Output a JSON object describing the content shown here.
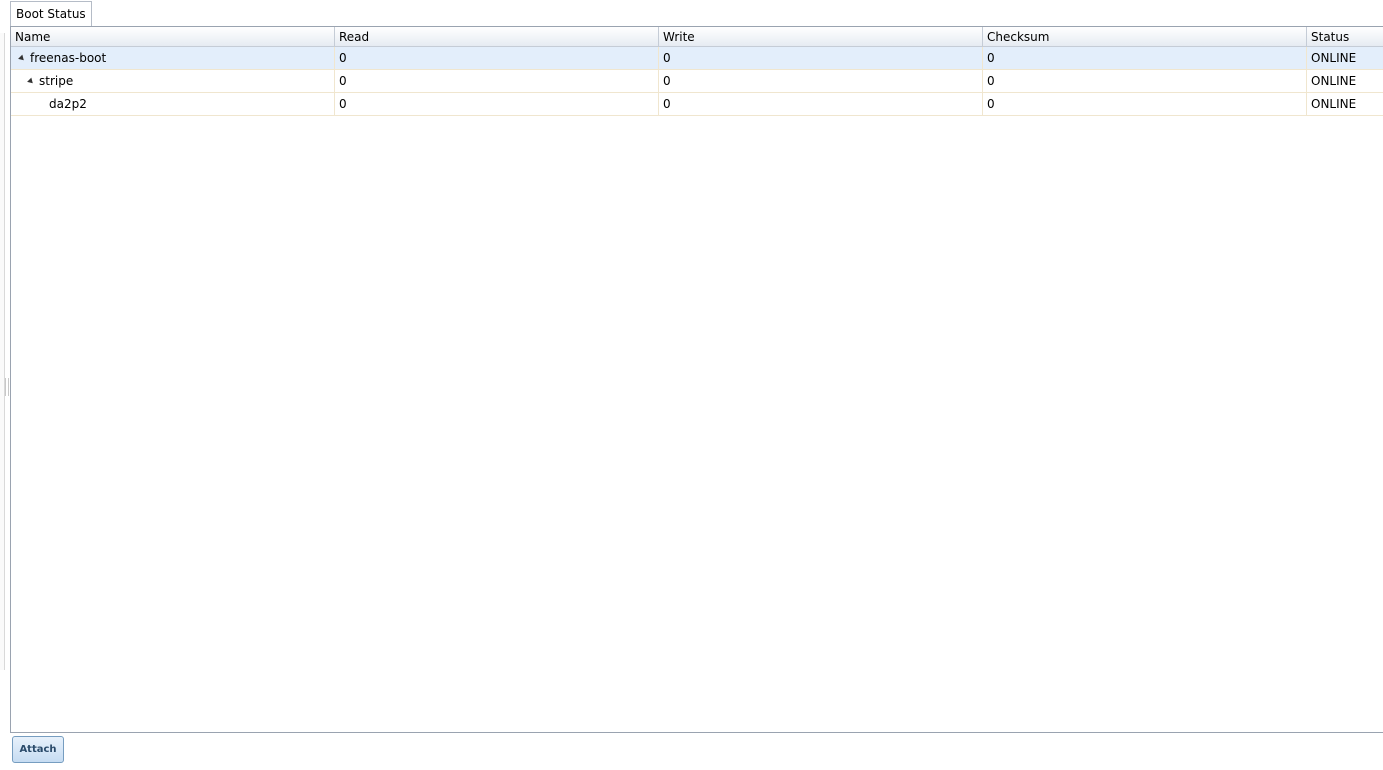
{
  "tabs": [
    {
      "label": "Boot Status"
    }
  ],
  "grid": {
    "columns": [
      "Name",
      "Read",
      "Write",
      "Checksum",
      "Status"
    ],
    "rows": [
      {
        "name": "freenas-boot",
        "read": "0",
        "write": "0",
        "checksum": "0",
        "status": "ONLINE"
      },
      {
        "name": "stripe",
        "read": "0",
        "write": "0",
        "checksum": "0",
        "status": "ONLINE"
      },
      {
        "name": "da2p2",
        "read": "0",
        "write": "0",
        "checksum": "0",
        "status": "ONLINE"
      }
    ]
  },
  "footer": {
    "attach_label": "Attach"
  },
  "icons": {
    "expander": "expanded-triangle-icon"
  },
  "colors": {
    "selected_row": "#e3eefb",
    "button_border": "#769dc0",
    "header_border": "#c5ccd6"
  }
}
